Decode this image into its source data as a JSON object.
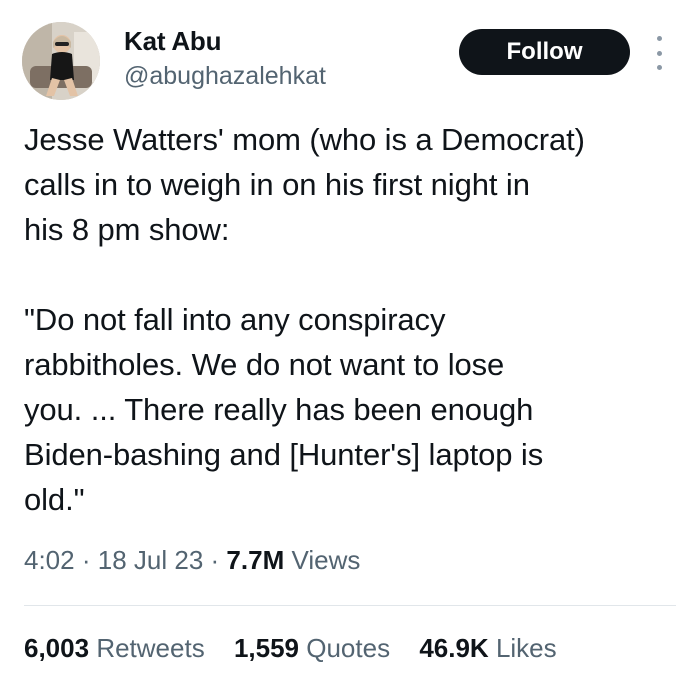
{
  "author": {
    "name": "Kat Abu",
    "handle": "@abughazalehkat"
  },
  "follow_label": "Follow",
  "tweet": {
    "text": "Jesse Watters' mom (who is a Democrat)\ncalls in to weigh in on his first night in\nhis 8 pm show:\n\n\"Do not fall into any conspiracy\nrabbitholes. We do not want to lose\nyou. ... There really has been enough\nBiden-bashing and [Hunter's] laptop is\nold.\""
  },
  "meta": {
    "time": "4:02",
    "separator": "·",
    "date": "18 Jul 23",
    "views_count": "7.7M",
    "views_label": "Views"
  },
  "stats": {
    "retweets_count": "6,003",
    "retweets_label": "Retweets",
    "quotes_count": "1,559",
    "quotes_label": "Quotes",
    "likes_count": "46.9K",
    "likes_label": "Likes"
  },
  "icons": {
    "more": "more-options-icon"
  }
}
